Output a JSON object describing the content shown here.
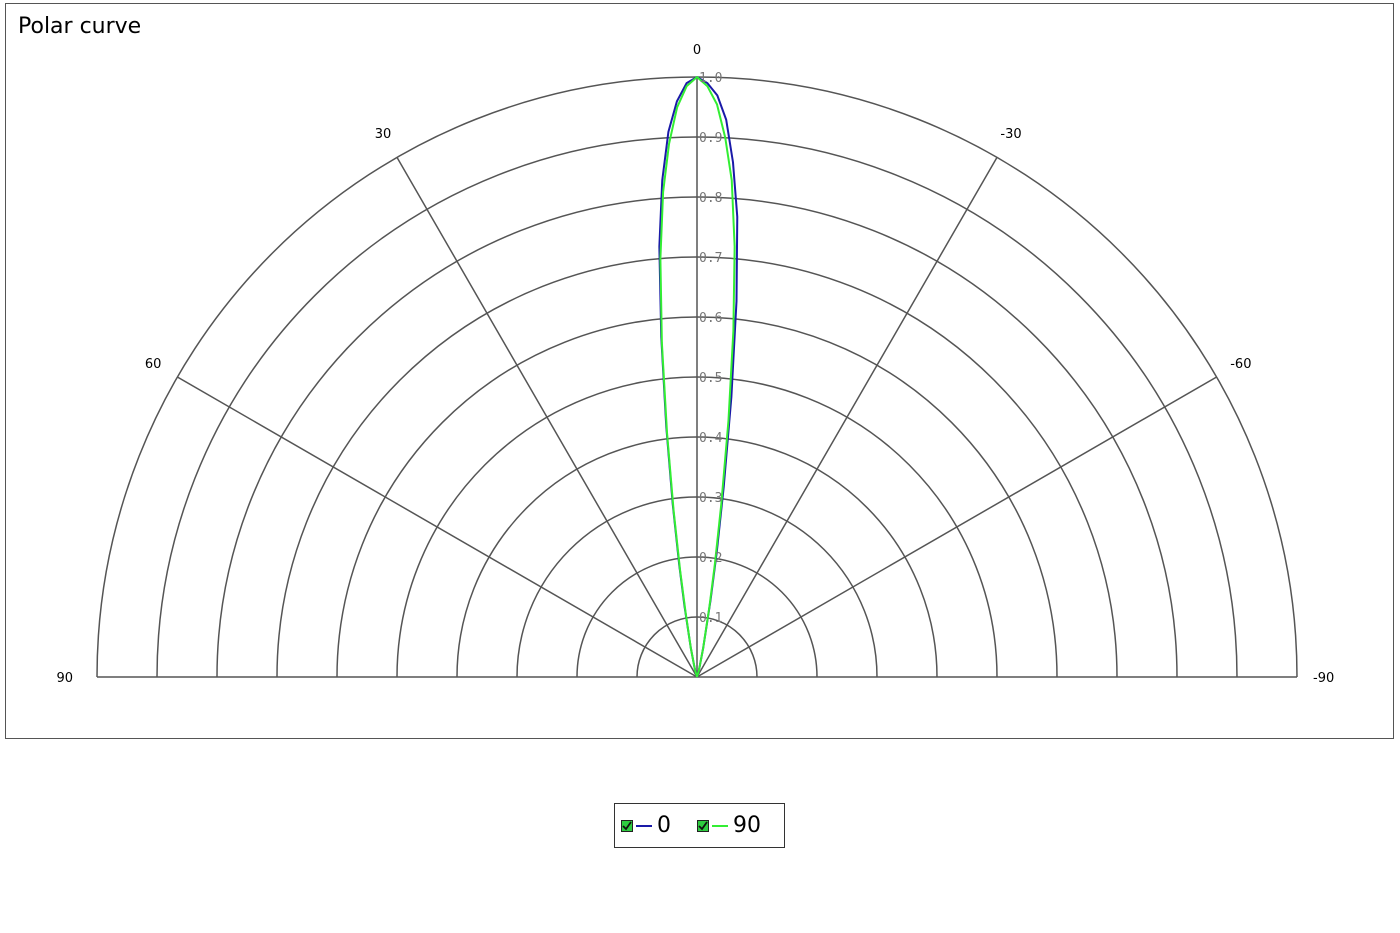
{
  "chart_data": {
    "type": "polar",
    "title": "Polar curve",
    "angle_ticks": [
      90,
      60,
      30,
      0,
      -30,
      -60,
      -90
    ],
    "angle_tick_labels": [
      "90",
      "60",
      "30",
      "0",
      "-30",
      "-60",
      "-90"
    ],
    "radial_range": [
      0,
      1.0
    ],
    "radial_ticks": [
      0.1,
      0.2,
      0.3,
      0.4,
      0.5,
      0.6,
      0.7,
      0.8,
      0.9,
      1.0
    ],
    "radial_tick_labels": [
      "0.1",
      "0.2",
      "0.3",
      "0.4",
      "0.5",
      "0.6",
      "0.7",
      "0.8",
      "0.9",
      "1.0"
    ],
    "grid": true,
    "legend": "bottom-center",
    "series": [
      {
        "name": "0",
        "color": "#1a1aa8",
        "angles": [
          0,
          1,
          2,
          3,
          4,
          5,
          6,
          7,
          8,
          9,
          10,
          12,
          14,
          16,
          18,
          20,
          25,
          30,
          -1,
          -2,
          -3,
          -4,
          -5,
          -6,
          -7,
          -8,
          -9,
          -10,
          -12,
          -14,
          -16,
          -18,
          -20,
          -25,
          -30
        ],
        "values": [
          1.0,
          0.99,
          0.96,
          0.91,
          0.83,
          0.72,
          0.57,
          0.42,
          0.29,
          0.19,
          0.12,
          0.05,
          0.02,
          0.01,
          0.0,
          0.0,
          0.0,
          0.0,
          0.99,
          0.97,
          0.93,
          0.86,
          0.77,
          0.63,
          0.47,
          0.32,
          0.21,
          0.13,
          0.05,
          0.02,
          0.01,
          0.0,
          0.0,
          0.0,
          0.0
        ]
      },
      {
        "name": "90",
        "color": "#33ee33",
        "angles": [
          0,
          1,
          2,
          3,
          4,
          5,
          6,
          7,
          8,
          9,
          10,
          12,
          14,
          16,
          18,
          20,
          25,
          30,
          -1,
          -2,
          -3,
          -4,
          -5,
          -6,
          -7,
          -8,
          -9,
          -10,
          -12,
          -14,
          -16,
          -18,
          -20,
          -25,
          -30
        ],
        "values": [
          1.0,
          0.985,
          0.95,
          0.89,
          0.81,
          0.7,
          0.56,
          0.41,
          0.28,
          0.18,
          0.11,
          0.05,
          0.02,
          0.01,
          0.0,
          0.0,
          0.0,
          0.0,
          0.985,
          0.955,
          0.9,
          0.83,
          0.72,
          0.58,
          0.43,
          0.29,
          0.19,
          0.12,
          0.05,
          0.02,
          0.01,
          0.0,
          0.0,
          0.0,
          0.0
        ]
      }
    ]
  },
  "legend": {
    "items": [
      {
        "label": "0",
        "color": "#1a1aa8"
      },
      {
        "label": "90",
        "color": "#33ee33"
      }
    ]
  }
}
